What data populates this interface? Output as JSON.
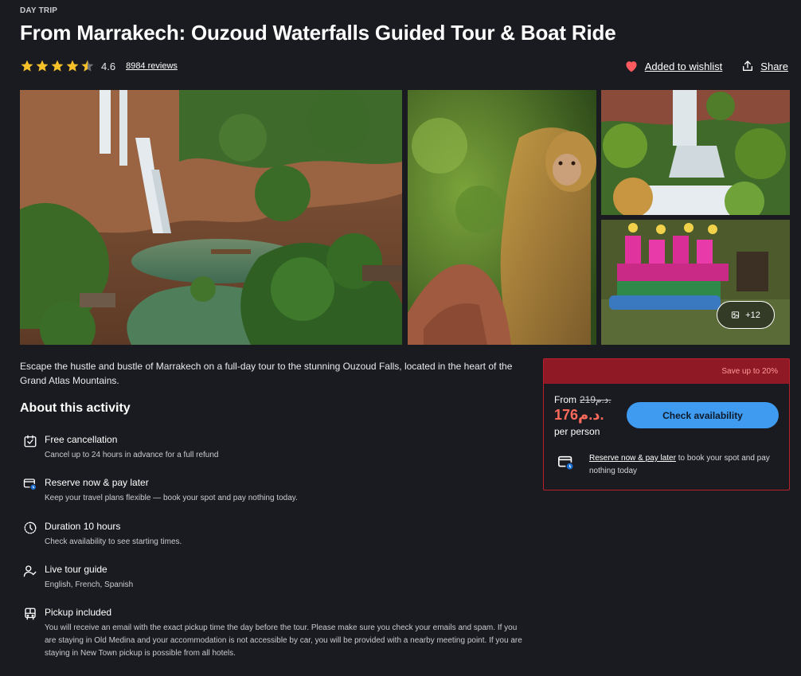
{
  "header": {
    "category": "DAY TRIP",
    "title": "From Marrakech: Ouzoud Waterfalls Guided Tour & Boat Ride",
    "rating_value": "4.6",
    "rating_stars": 4.6,
    "reviews_label": "8984 reviews",
    "wishlist_label": "Added to wishlist",
    "share_label": "Share"
  },
  "gallery": {
    "more_photos_label": "+12",
    "images": [
      "waterfall-canyon",
      "barbary-macaque",
      "cascade-pools",
      "pink-boats"
    ]
  },
  "description": "Escape the hustle and bustle of Marrakech on a full-day tour to the stunning Ouzoud Falls, located in the heart of the Grand Atlas Mountains.",
  "about": {
    "title": "About this activity",
    "features": [
      {
        "icon": "calendar-check-icon",
        "title": "Free cancellation",
        "desc": "Cancel up to 24 hours in advance for a full refund"
      },
      {
        "icon": "reserve-pay-later-icon",
        "title": "Reserve now & pay later",
        "desc": "Keep your travel plans flexible — book your spot and pay nothing today."
      },
      {
        "icon": "clock-icon",
        "title": "Duration 10 hours",
        "desc": "Check availability to see starting times."
      },
      {
        "icon": "guide-icon",
        "title": "Live tour guide",
        "desc": "English, French, Spanish"
      },
      {
        "icon": "bus-icon",
        "title": "Pickup included",
        "desc": "You will receive an email with the exact pickup time the day before the tour. Please make sure you check your emails and spam. If you are staying in Old Medina and your accommodation is not accessible by car, you will be provided with a nearby meeting point. If you are staying in New Town pickup is possible from all hotels."
      }
    ]
  },
  "booking": {
    "save_label": "Save up to 20%",
    "from_label": "From",
    "old_price": "219د.م.",
    "new_price": "176د.م.",
    "per_person": "per person",
    "check_button": "Check availability",
    "reserve_link": "Reserve now & pay later",
    "reserve_text": " to book your spot and pay nothing today"
  },
  "colors": {
    "background": "#1a1b20",
    "accent_blue": "#3f9bf0",
    "price_red": "#ff6a5c",
    "save_bar": "#8f1a26",
    "star": "#f7c12a",
    "heart": "#ff5a5f"
  }
}
